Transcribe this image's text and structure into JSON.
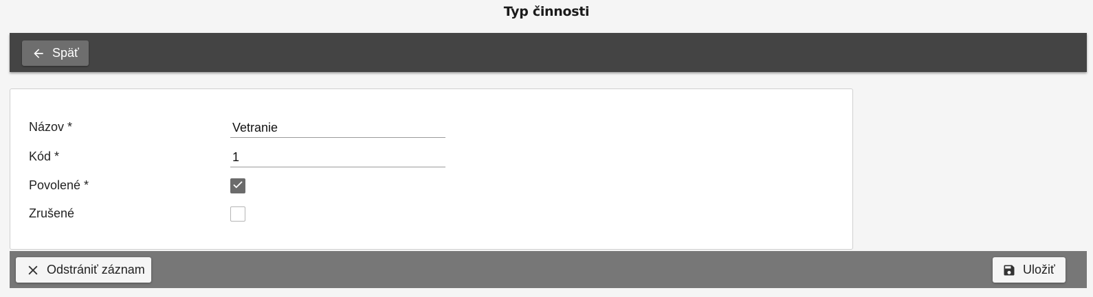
{
  "header": {
    "title": "Typ činnosti"
  },
  "toolbar": {
    "back_label": "Späť"
  },
  "form": {
    "name": {
      "label": "Názov *",
      "value": "Vetranie"
    },
    "code": {
      "label": "Kód *",
      "value": "1"
    },
    "enabled": {
      "label": "Povolené *",
      "checked": true
    },
    "cancelled": {
      "label": "Zrušené",
      "checked": false
    }
  },
  "actions": {
    "delete_label": "Odstrániť záznam",
    "save_label": "Uložiť"
  },
  "icons": {
    "back": "arrow-left-icon",
    "delete": "close-icon",
    "save": "floppy-disk-icon",
    "check": "checkmark-icon"
  }
}
